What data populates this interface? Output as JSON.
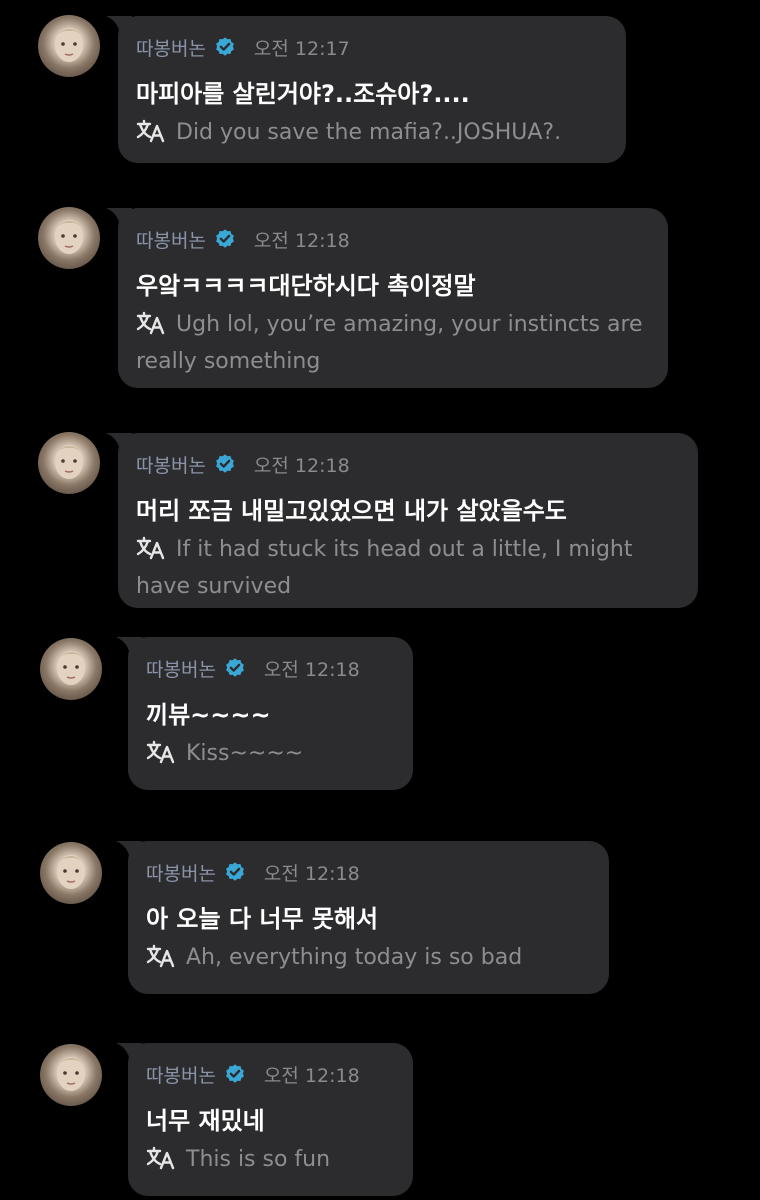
{
  "colors": {
    "background": "#000000",
    "bubble": "#2c2c2e",
    "verified_badge": "#3aa8d6",
    "name": "#8a93a8",
    "time": "#8a8a8f",
    "message": "#ffffff",
    "translation": "#8d8d92"
  },
  "icons": {
    "verified": "verified-badge-icon",
    "translate": "translate-icon"
  },
  "messages": [
    {
      "author": "따봉버논",
      "time": "오전 12:17",
      "text": "마피아를 살린거야?..조슈아?....",
      "translation": "Did you save the mafia?..JOSHUA?."
    },
    {
      "author": "따봉버논",
      "time": "오전 12:18",
      "text": "우앜ㅋㅋㅋㅋ대단하시다 촉이정말",
      "translation": "Ugh lol, you’re amazing, your instincts are really something"
    },
    {
      "author": "따봉버논",
      "time": "오전 12:18",
      "text": "머리 쪼금 내밀고있었으면 내가 살았을수도",
      "translation": "If it had stuck its head out a little, I might have survived"
    },
    {
      "author": "따봉버논",
      "time": "오전 12:18",
      "text": "끼뷰~~~~",
      "translation": "Kiss~~~~"
    },
    {
      "author": "따봉버논",
      "time": "오전 12:18",
      "text": "아 오늘 다 너무 못해서",
      "translation": "Ah, everything today is so bad"
    },
    {
      "author": "따봉버논",
      "time": "오전 12:18",
      "text": "너무 재밌네",
      "translation": "This is so fun"
    }
  ]
}
